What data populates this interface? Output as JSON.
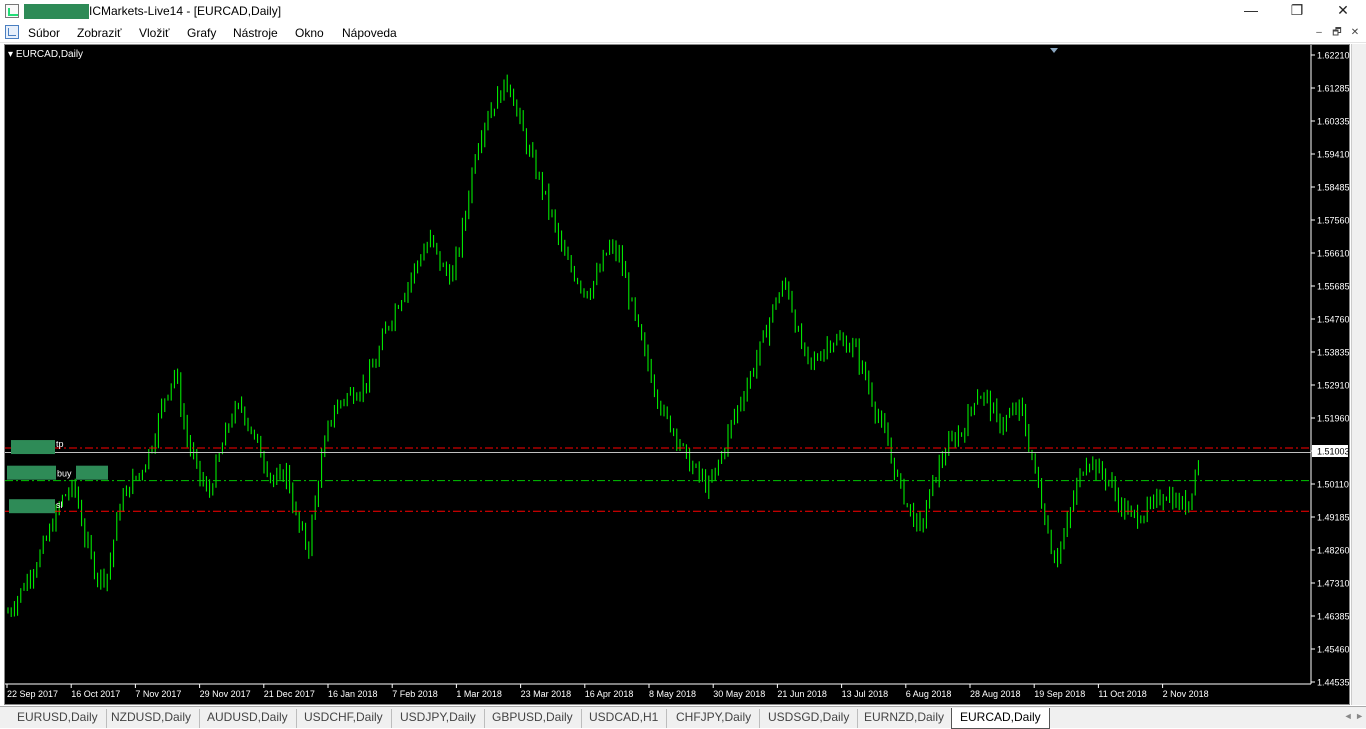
{
  "window": {
    "title": "ICMarkets-Live14 - [EURCAD,Daily]",
    "minimize": "—",
    "restore": "❐",
    "close": "✕"
  },
  "menu": {
    "items": [
      "Súbor",
      "Zobraziť",
      "Vložiť",
      "Grafy",
      "Nástroje",
      "Okno",
      "Nápoveda"
    ],
    "mdi": {
      "minimize": "–",
      "restore": "🗗",
      "close": "✕"
    }
  },
  "chart": {
    "label": "EURCAD,Daily",
    "current_price": "1.51003",
    "line_labels": {
      "tp": "tp",
      "buy": "buy",
      "sl": "sl"
    },
    "colors": {
      "background": "#000000",
      "candle": "#00ff00",
      "tp_line": "#ff0000",
      "sl_line": "#ff0000",
      "buy_line": "#00c800",
      "price_line": "#c0c0c0",
      "label_mask": "#2e8b57",
      "axis_text": "#ffffff"
    }
  },
  "chart_data": {
    "type": "candlestick",
    "symbol": "EURCAD",
    "timeframe": "Daily",
    "price_axis_labels": [
      "1.62210",
      "1.61285",
      "1.60335",
      "1.59410",
      "1.58485",
      "1.57560",
      "1.56610",
      "1.55685",
      "1.54760",
      "1.53835",
      "1.52910",
      "1.51960",
      "1.51003",
      "1.50110",
      "1.49185",
      "1.48260",
      "1.47310",
      "1.46385",
      "1.45460",
      "1.44535"
    ],
    "date_axis_labels": [
      "22 Sep 2017",
      "16 Oct 2017",
      "7 Nov 2017",
      "29 Nov 2017",
      "21 Dec 2017",
      "16 Jan 2018",
      "7 Feb 2018",
      "1 Mar 2018",
      "23 Mar 2018",
      "16 Apr 2018",
      "8 May 2018",
      "30 May 2018",
      "21 Jun 2018",
      "13 Jul 2018",
      "6 Aug 2018",
      "28 Aug 2018",
      "19 Sep 2018",
      "11 Oct 2018",
      "2 Nov 2018"
    ],
    "ylim": [
      1.44535,
      1.6221
    ],
    "levels": {
      "tp": 1.5113,
      "buy": 1.5021,
      "sl": 1.4935,
      "current": 1.51003
    },
    "approx_closes": [
      1.465,
      1.47,
      1.476,
      1.482,
      1.49,
      1.498,
      1.5,
      1.485,
      1.475,
      1.476,
      1.495,
      1.501,
      1.505,
      1.513,
      1.525,
      1.533,
      1.515,
      1.505,
      1.498,
      1.509,
      1.52,
      1.523,
      1.515,
      1.508,
      1.501,
      1.505,
      1.49,
      1.483,
      1.505,
      1.52,
      1.525,
      1.527,
      1.529,
      1.535,
      1.545,
      1.552,
      1.558,
      1.565,
      1.57,
      1.562,
      1.56,
      1.575,
      1.595,
      1.605,
      1.61,
      1.615,
      1.603,
      1.593,
      1.585,
      1.575,
      1.565,
      1.56,
      1.555,
      1.56,
      1.568,
      1.565,
      1.552,
      1.54,
      1.53,
      1.52,
      1.516,
      1.508,
      1.504,
      1.5,
      1.508,
      1.518,
      1.526,
      1.534,
      1.543,
      1.553,
      1.558,
      1.543,
      1.534,
      1.538,
      1.542,
      1.541,
      1.54,
      1.532,
      1.522,
      1.513,
      1.502,
      1.494,
      1.488,
      1.5,
      1.509,
      1.514,
      1.517,
      1.527,
      1.525,
      1.518,
      1.52,
      1.523,
      1.509,
      1.495,
      1.48,
      1.487,
      1.5,
      1.509,
      1.505,
      1.502,
      1.495,
      1.492,
      1.493,
      1.495,
      1.499,
      1.496,
      1.495,
      1.508
    ]
  },
  "tabs": [
    "EURUSD,Daily",
    "NZDUSD,Daily",
    "AUDUSD,Daily",
    "USDCHF,Daily",
    "USDJPY,Daily",
    "GBPUSD,Daily",
    "USDCAD,H1",
    "CHFJPY,Daily",
    "USDSGD,Daily",
    "EURNZD,Daily",
    "EURCAD,Daily"
  ],
  "active_tab": "EURCAD,Daily",
  "tab_scroll": "◄ ►"
}
